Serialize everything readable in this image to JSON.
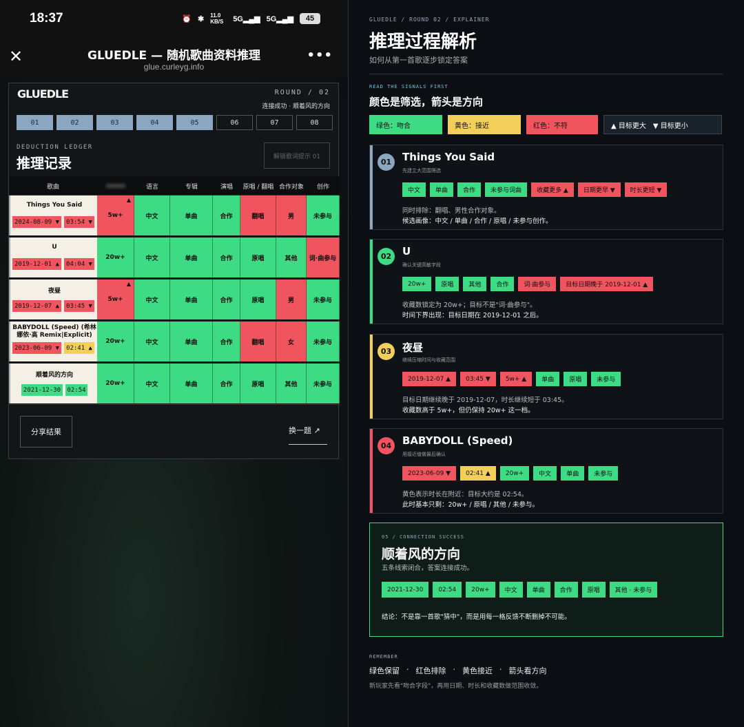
{
  "status": {
    "time": "18:37",
    "speed": "11.0 KB/S",
    "sig1": "5G",
    "sig2": "5G",
    "battery": "45"
  },
  "titlebar": {
    "title": "GLUEDLE — 随机歌曲资料推理",
    "url": "glue.curleyg.info",
    "more": "•••",
    "close": "✕"
  },
  "card": {
    "logo": "GLUEDLE",
    "round": "ROUND / 02",
    "round_sub": "连接成功 · 顺着风的方向",
    "steps": [
      "01",
      "02",
      "03",
      "04",
      "05",
      "06",
      "07",
      "08"
    ],
    "ledger_label": "DEDUCTION LEDGER",
    "ledger_title": "推理记录",
    "lyric_btn": "解锁歌词提示 01",
    "headers": [
      "歌曲",
      "",
      "语言",
      "专辑",
      "演唱",
      "原唱 / 翻唱",
      "合作对象",
      "创作"
    ],
    "rows": [
      {
        "song": "Things You Said",
        "date": "2024-08-09 ▼",
        "dur": "03:54 ▼",
        "dateC": "R",
        "durC": "R",
        "cells": [
          {
            "v": "5w+",
            "c": "R",
            "a": "▲"
          },
          {
            "v": "中文",
            "c": "G"
          },
          {
            "v": "单曲",
            "c": "G"
          },
          {
            "v": "合作",
            "c": "G"
          },
          {
            "v": "翻唱",
            "c": "R"
          },
          {
            "v": "男",
            "c": "R"
          },
          {
            "v": "未参与",
            "c": "G"
          }
        ]
      },
      {
        "song": "U",
        "date": "2019-12-01 ▲",
        "dur": "04:04 ▼",
        "dateC": "R",
        "durC": "R",
        "cells": [
          {
            "v": "20w+",
            "c": "G"
          },
          {
            "v": "中文",
            "c": "G"
          },
          {
            "v": "单曲",
            "c": "G"
          },
          {
            "v": "合作",
            "c": "G"
          },
          {
            "v": "原唱",
            "c": "G"
          },
          {
            "v": "其他",
            "c": "G"
          },
          {
            "v": "词·曲参与",
            "c": "R"
          }
        ]
      },
      {
        "song": "夜昼",
        "date": "2019-12-07 ▲",
        "dur": "03:45 ▼",
        "dateC": "R",
        "durC": "R",
        "cells": [
          {
            "v": "5w+",
            "c": "R",
            "a": "▲"
          },
          {
            "v": "中文",
            "c": "G"
          },
          {
            "v": "单曲",
            "c": "G"
          },
          {
            "v": "合作",
            "c": "G"
          },
          {
            "v": "原唱",
            "c": "G"
          },
          {
            "v": "男",
            "c": "R"
          },
          {
            "v": "未参与",
            "c": "G"
          }
        ]
      },
      {
        "song": "BABYDOLL (Speed) (希林娜依·高 Remix|Explicit)",
        "date": "2023-06-09 ▼",
        "dur": "02:41 ▲",
        "dateC": "R",
        "durC": "Y",
        "cells": [
          {
            "v": "20w+",
            "c": "G"
          },
          {
            "v": "中文",
            "c": "G"
          },
          {
            "v": "单曲",
            "c": "G"
          },
          {
            "v": "合作",
            "c": "G"
          },
          {
            "v": "翻唱",
            "c": "R"
          },
          {
            "v": "女",
            "c": "R"
          },
          {
            "v": "未参与",
            "c": "G"
          }
        ]
      },
      {
        "song": "顺着风的方向",
        "date": "2021-12-30",
        "dur": "02:54",
        "dateC": "G",
        "durC": "G",
        "cells": [
          {
            "v": "20w+",
            "c": "G"
          },
          {
            "v": "中文",
            "c": "G"
          },
          {
            "v": "单曲",
            "c": "G"
          },
          {
            "v": "合作",
            "c": "G"
          },
          {
            "v": "原唱",
            "c": "G"
          },
          {
            "v": "其他",
            "c": "G"
          },
          {
            "v": "未参与",
            "c": "G"
          }
        ]
      }
    ],
    "share": "分享结果",
    "next": "换一题 ↗"
  },
  "explainer": {
    "kicker": "GLUEDLE / ROUND 02 / EXPLAINER",
    "title": "推理过程解析",
    "subtitle": "如何从第一首歌逐步锁定答案",
    "signals_label": "READ THE SIGNALS FIRST",
    "signals_title": "颜色是筛选，箭头是方向",
    "legend": [
      {
        "t": "绿色：吻合",
        "c": "#3ddc84"
      },
      {
        "t": "黄色：接近",
        "c": "#f2cf5b"
      },
      {
        "t": "红色：不符",
        "c": "#f0545e"
      },
      {
        "t": "▲ 目标更大　▼ 目标更小",
        "c": "dark"
      }
    ],
    "steps": [
      {
        "n": "01",
        "name": "Things You Said",
        "tag": "先建立大范围筛选",
        "color": "#8aa6c0",
        "chips": [
          {
            "t": "中文",
            "c": "G"
          },
          {
            "t": "单曲",
            "c": "G"
          },
          {
            "t": "合作",
            "c": "G"
          },
          {
            "t": "未参与词曲",
            "c": "G"
          },
          {
            "t": "收藏更多 ▲",
            "c": "R"
          },
          {
            "t": "日期更早 ▼",
            "c": "R"
          },
          {
            "t": "时长更短 ▼",
            "c": "R"
          }
        ],
        "l1": "同时排除：翻唱、男性合作对象。",
        "l2": "候选画像：中文 / 单曲 / 合作 / 原唱 / 未参与创作。"
      },
      {
        "n": "02",
        "name": "U",
        "tag": "确认关键高敏字段",
        "color": "#3ddc84",
        "chips": [
          {
            "t": "20w+",
            "c": "G"
          },
          {
            "t": "原唱",
            "c": "G"
          },
          {
            "t": "其他",
            "c": "G"
          },
          {
            "t": "合作",
            "c": "G"
          },
          {
            "t": "词·曲参与",
            "c": "R"
          },
          {
            "t": "目标日期晚于 2019-12-01 ▲",
            "c": "R"
          }
        ],
        "l1": "收藏数锁定为 20w+；目标不是\"词·曲参与\"。",
        "l2": "时间下界出现：目标日期在 2019-12-01 之后。"
      },
      {
        "n": "03",
        "name": "夜昼",
        "tag": "继续压缩时间与收藏范围",
        "color": "#f2cf5b",
        "chips": [
          {
            "t": "2019-12-07 ▲",
            "c": "R"
          },
          {
            "t": "03:45 ▼",
            "c": "R"
          },
          {
            "t": "5w+ ▲",
            "c": "R"
          },
          {
            "t": "单曲",
            "c": "G"
          },
          {
            "t": "原唱",
            "c": "G"
          },
          {
            "t": "未参与",
            "c": "G"
          }
        ],
        "l1": "目标日期继续晚于 2019-12-07，时长继续短于 03:45。",
        "l2": "收藏数高于 5w+，但仍保持 20w+ 这一档。"
      },
      {
        "n": "04",
        "name": "BABYDOLL (Speed)",
        "tag": "用接近值做最后确认",
        "color": "#f0545e",
        "chips": [
          {
            "t": "2023-06-09 ▼",
            "c": "R"
          },
          {
            "t": "02:41 ▲",
            "c": "Y"
          },
          {
            "t": "20w+",
            "c": "G"
          },
          {
            "t": "中文",
            "c": "G"
          },
          {
            "t": "单曲",
            "c": "G"
          },
          {
            "t": "未参与",
            "c": "G"
          }
        ],
        "l1": "黄色表示时长在附近：目标大约是 02:54。",
        "l2": "此时基本只剩：20w+ / 原唱 / 其他 / 未参与。"
      }
    ],
    "final": {
      "kicker": "05 / CONNECTION SUCCESS",
      "name": "顺着风的方向",
      "sub": "五条线索闭合，答案连接成功。",
      "chips": [
        "2021-12-30",
        "02:54",
        "20w+",
        "中文",
        "单曲",
        "合作",
        "原唱",
        "其他 · 未参与"
      ],
      "conclusion": "结论：不是靠一首歌\"猜中\"，而是用每一格反馈不断删掉不可能。"
    },
    "remember_label": "REMEMBER",
    "remember": [
      "绿色保留",
      "·",
      "红色排除",
      "·",
      "黄色接近",
      "·",
      "箭头看方向"
    ],
    "remember_note": "新玩家先看\"吻合字段\"，再用日期、时长和收藏数做范围收敛。"
  }
}
